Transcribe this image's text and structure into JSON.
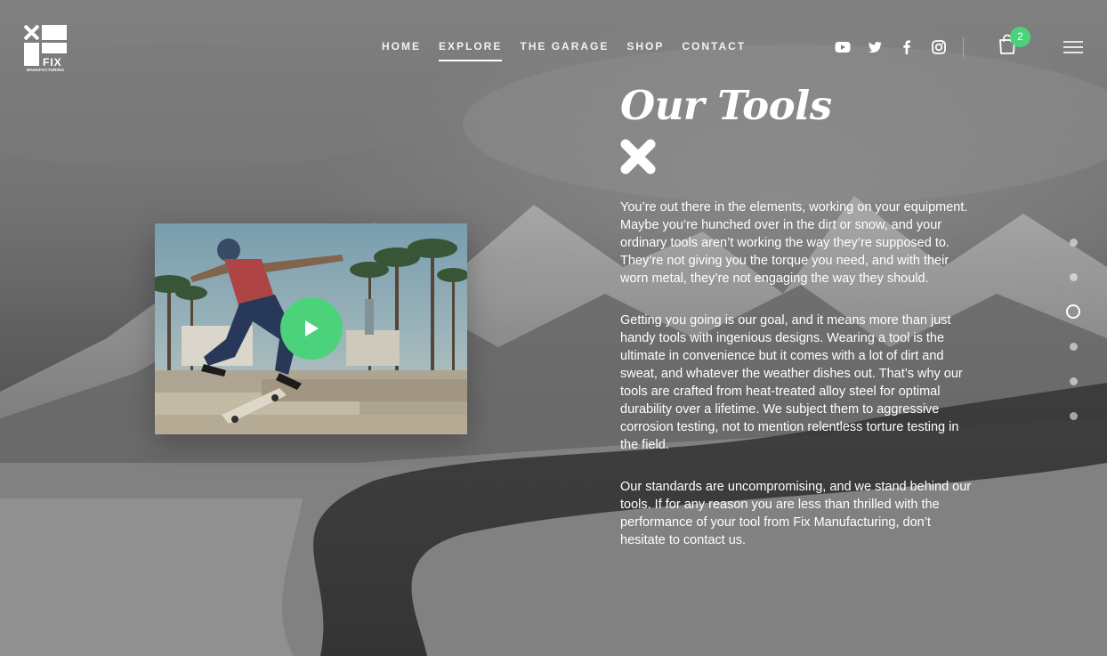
{
  "brand": {
    "name": "FIX",
    "tagline": "MANUFACTURING",
    "accent": "#4cd27a"
  },
  "nav": {
    "items": [
      {
        "label": "HOME"
      },
      {
        "label": "EXPLORE",
        "active": true
      },
      {
        "label": "THE GARAGE"
      },
      {
        "label": "SHOP"
      },
      {
        "label": "CONTACT"
      }
    ]
  },
  "social": [
    "youtube-icon",
    "twitter-icon",
    "facebook-icon",
    "instagram-icon"
  ],
  "cart": {
    "count": "2"
  },
  "content": {
    "title": "Our Tools",
    "paragraphs": [
      "You’re out there in the elements, working on your equipment. Maybe you’re hunched over in the dirt or snow, and your ordinary tools aren’t working the way they’re supposed to. They’re not giving you the torque you need, and with their worn metal, they’re not engaging the way they should.",
      "Getting you going is our goal, and it means more than just handy tools with ingenious designs. Wearing a tool is the ultimate in convenience but it comes with a lot of dirt and sweat, and whatever the weather dishes out. That’s why our tools are crafted from heat-treated alloy steel for optimal durability over a lifetime. We subject them to aggressive corrosion testing, not to mention relentless torture testing in the field.",
      "Our standards are uncompromising, and we stand behind our tools. If for any reason you are less than thrilled with the performance of your tool from Fix Manufacturing, don’t hesitate to contact us."
    ]
  },
  "sections": {
    "count": 6,
    "active_index": 2
  }
}
